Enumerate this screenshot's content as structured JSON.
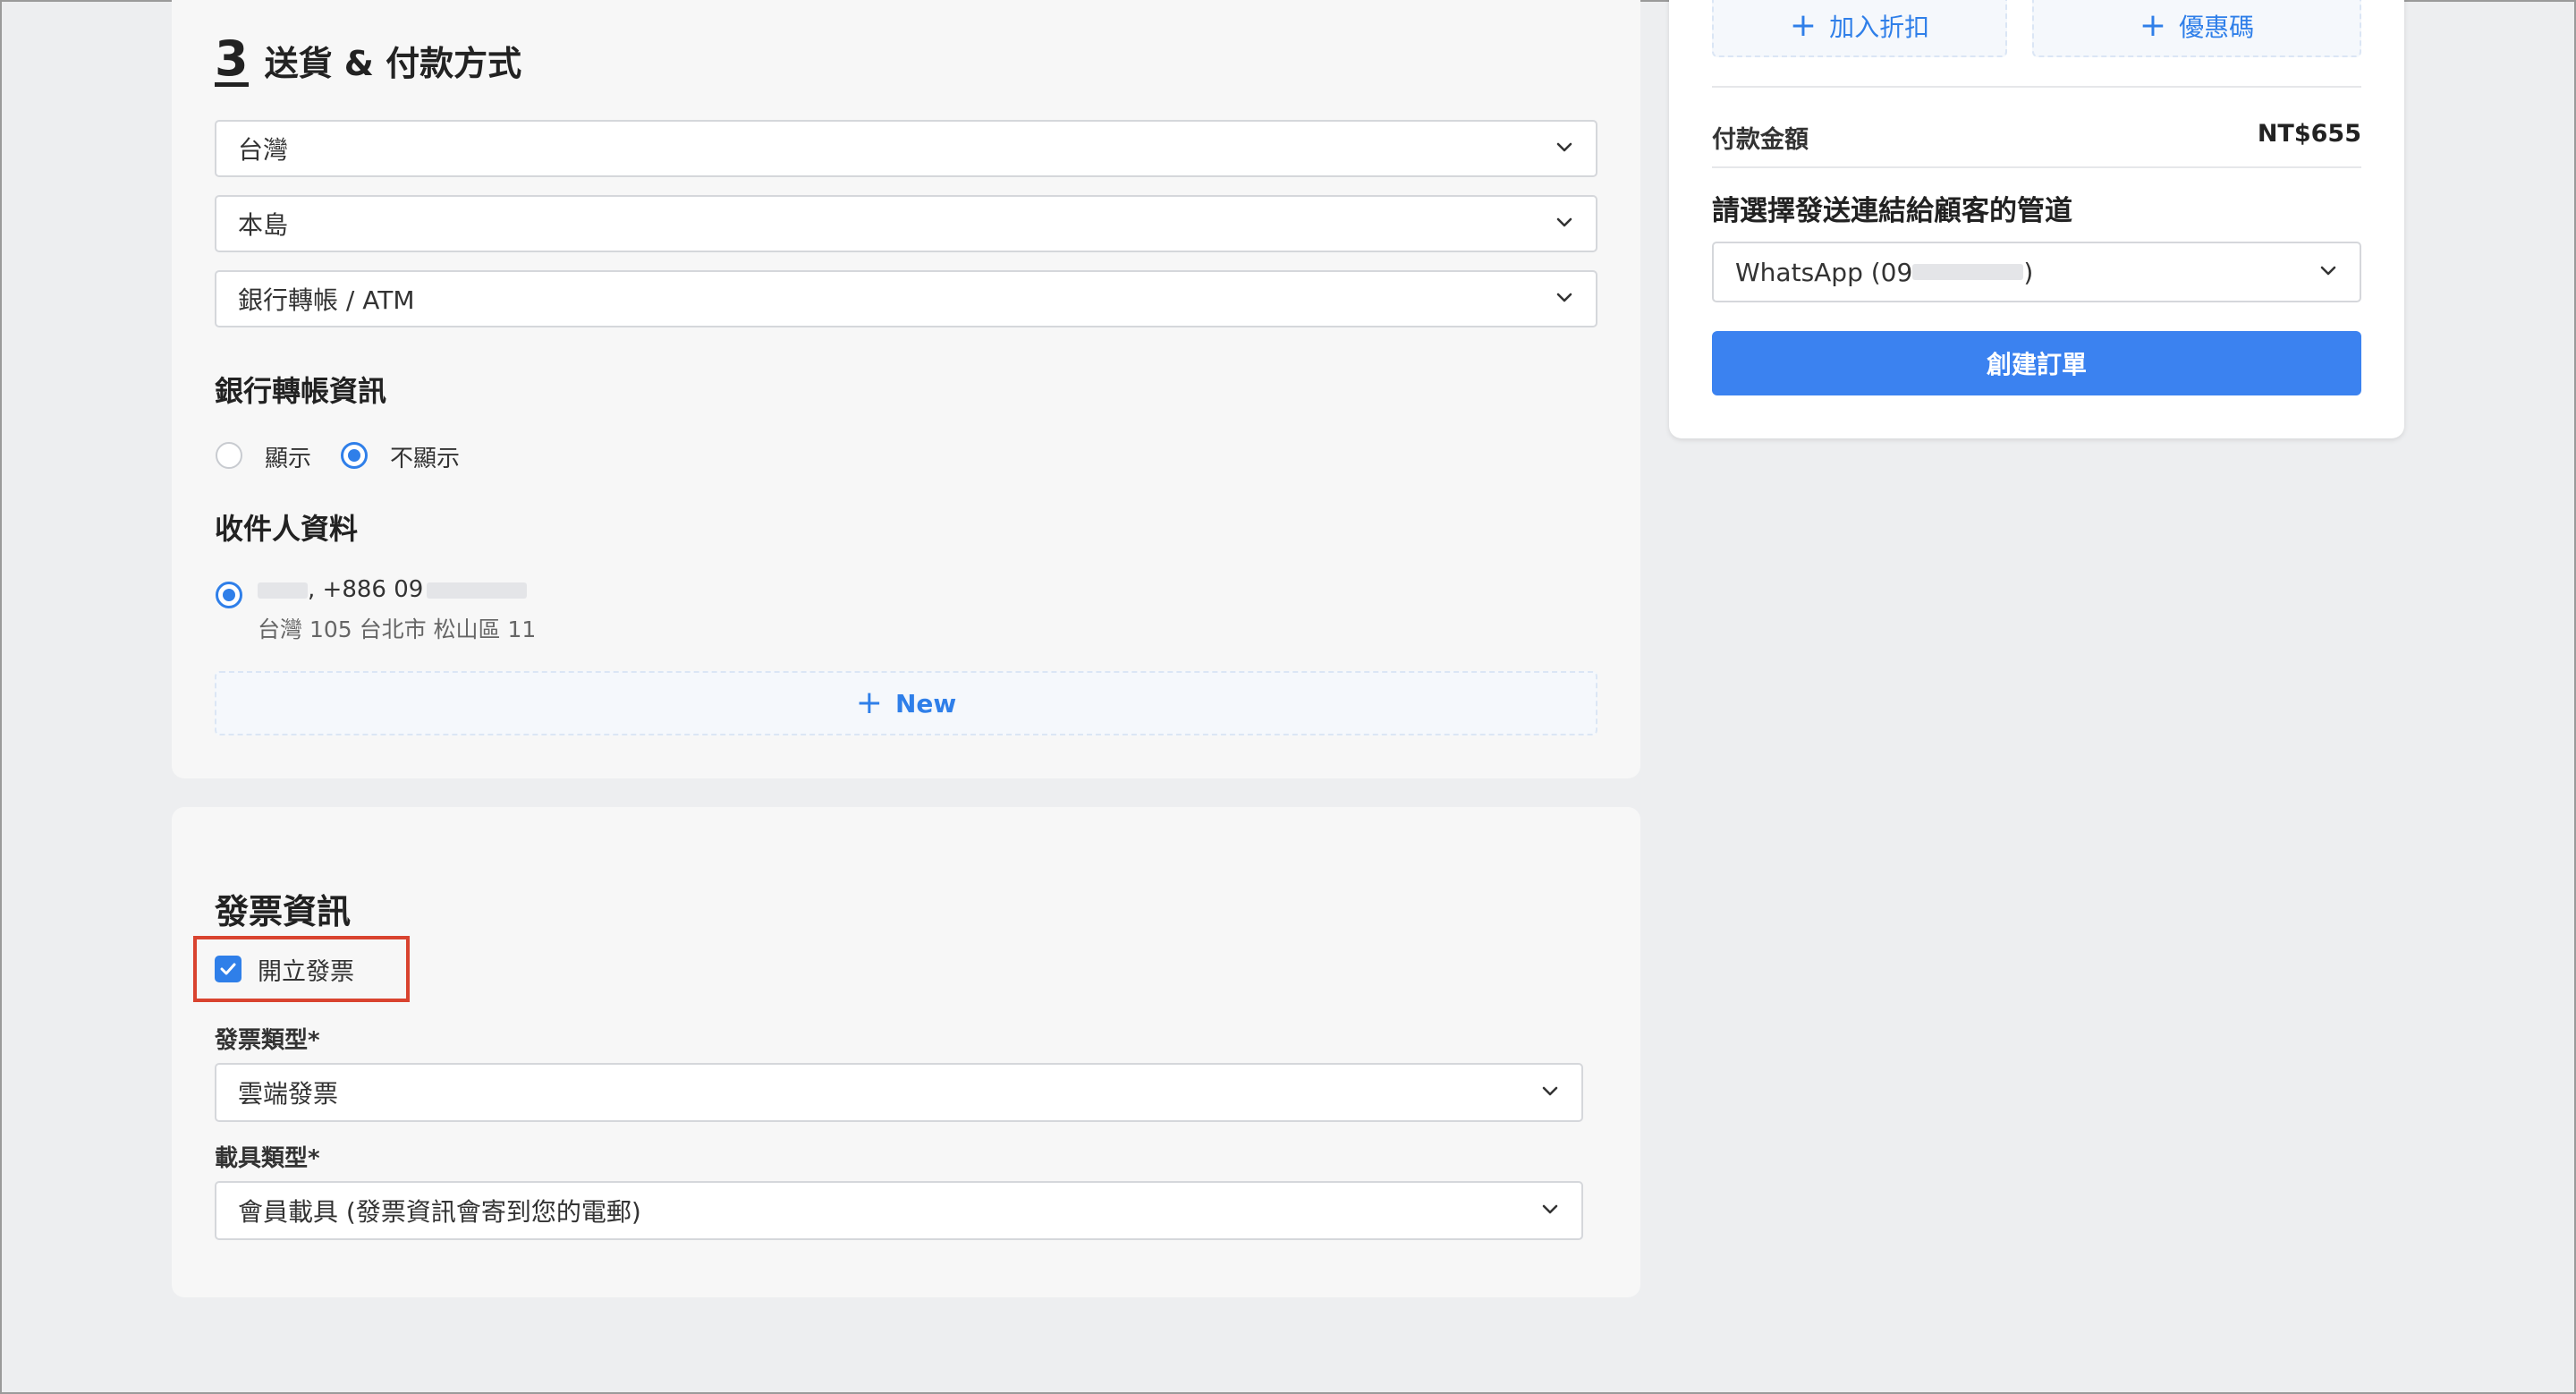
{
  "shipping_section": {
    "step_number": "3",
    "title": "送貨 & 付款方式",
    "country_select": "台灣",
    "region_select": "本島",
    "payment_select": "銀行轉帳 / ATM",
    "bank_info_heading": "銀行轉帳資訊",
    "bank_info_options": [
      "顯示",
      "不顯示"
    ],
    "bank_info_selected": "不顯示",
    "recipient_heading": "收件人資料",
    "recipient": {
      "phone": ", +886 09",
      "address": "台灣 105 台北市 松山區 11"
    },
    "new_recipient_label": "New"
  },
  "summary": {
    "add_discount_label": "加入折扣",
    "coupon_label": "優惠碼",
    "payment_amount_label": "付款金額",
    "payment_amount_value": "NT$655",
    "channel_heading": "請選擇發送連結給顧客的管道",
    "channel_select": "WhatsApp (09",
    "channel_select_end": ")",
    "create_order_label": "創建訂單"
  },
  "invoice_section": {
    "title": "發票資訊",
    "issue_invoice_label": "開立發票",
    "issue_invoice_checked": true,
    "invoice_type_label": "發票類型*",
    "invoice_type_value": "雲端發票",
    "carrier_type_label": "載具類型*",
    "carrier_type_value": "會員載具 (發票資訊會寄到您的電郵)"
  },
  "colors": {
    "accent": "#2f7fe9",
    "primary_button": "#3b82f0",
    "highlight_border": "#d9432f",
    "page_background": "#edeef0"
  }
}
